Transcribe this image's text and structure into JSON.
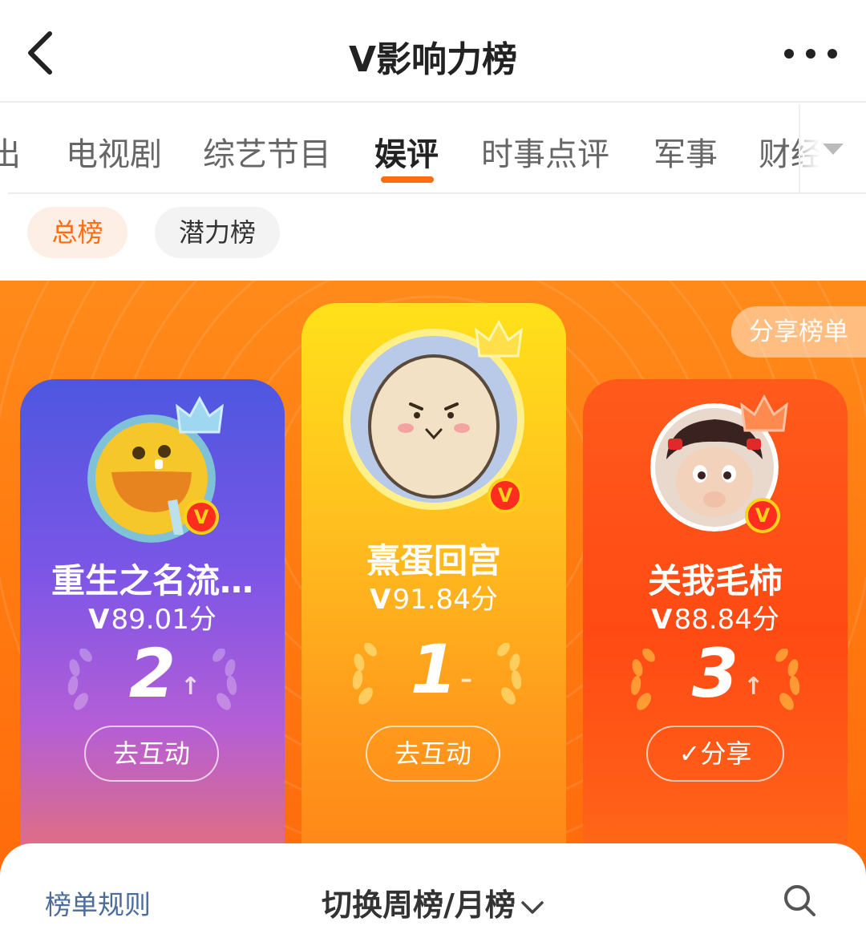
{
  "header": {
    "title": "V影响力榜",
    "back_icon": "chevron-left-icon",
    "more_icon": "more-dots-icon"
  },
  "categories": {
    "tabs": [
      {
        "label": "出"
      },
      {
        "label": "电视剧"
      },
      {
        "label": "综艺节目"
      },
      {
        "label": "娱评",
        "active": true
      },
      {
        "label": "时事点评"
      },
      {
        "label": "军事"
      },
      {
        "label": "财经"
      }
    ],
    "dropdown_icon": "triangle-down-icon"
  },
  "subtabs": {
    "total": "总榜",
    "potential": "潜力榜"
  },
  "board": {
    "share_list": "分享榜单",
    "cards": {
      "first": {
        "name": "熹蛋回宫",
        "v": "V",
        "score": "91.84分",
        "rank": "1",
        "trend": "–",
        "action": "去互动"
      },
      "second": {
        "name": "重生之名流…",
        "v": "V",
        "score": "89.01分",
        "rank": "2",
        "trend": "↑",
        "action": "去互动"
      },
      "third": {
        "name": "关我毛柿",
        "v": "V",
        "score": "88.84分",
        "rank": "3",
        "trend": "↑",
        "action": "✓分享"
      }
    },
    "verified_badge": "V"
  },
  "footer": {
    "rules": "榜单规则",
    "switch": "切换周榜/月榜",
    "search_icon": "search-icon"
  },
  "colors": {
    "accent": "#ff6d10",
    "board": "#ff7a10",
    "card_second": "#4d57e0",
    "card_first": "#ffd51f",
    "card_third": "#ff4a14",
    "link": "#4a6d9e"
  }
}
